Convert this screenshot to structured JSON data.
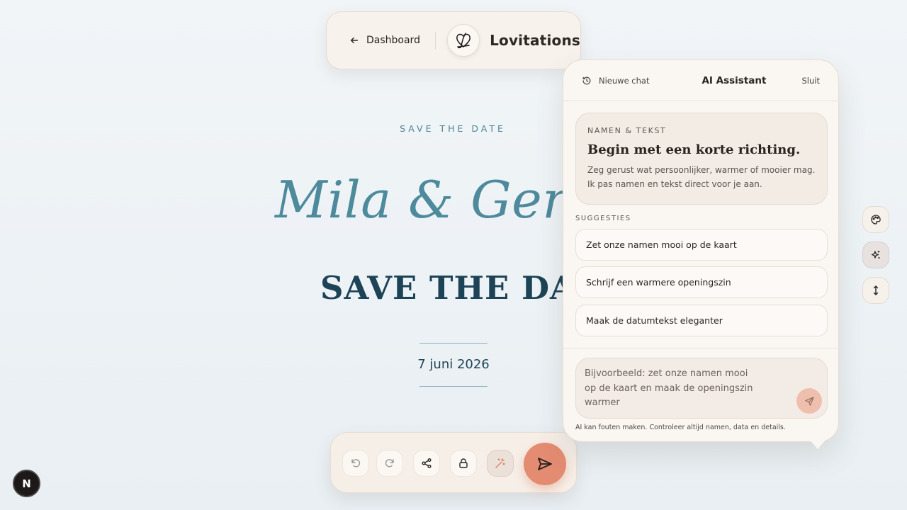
{
  "header": {
    "back_label": "Dashboard",
    "brand_name": "Lovitations",
    "logo_icon": "heart-signature-icon"
  },
  "canvas": {
    "eyebrow": "SAVE THE DATE",
    "names": "Mila & Gertj",
    "headline": "SAVE THE DAT",
    "date": "7 juni 2026"
  },
  "toolbar": {
    "buttons": [
      "undo-icon",
      "redo-icon",
      "share-icon",
      "lock-icon",
      "magic-wand-icon"
    ],
    "send_icon": "send-icon",
    "accent": "#e38c72"
  },
  "ai_panel": {
    "new_chat_label": "Nieuwe chat",
    "title": "AI Assistant",
    "close_label": "Sluit",
    "intro": {
      "eyebrow": "NAMEN & TEKST",
      "heading": "Begin met een korte richting.",
      "body": "Zeg gerust wat persoonlijker, warmer of mooier mag. Ik pas namen en tekst direct voor je aan."
    },
    "suggestions_label": "SUGGESTIES",
    "suggestions": [
      "Zet onze namen mooi op de kaart",
      "Schrijf een warmere openingszin",
      "Maak de datumtekst eleganter"
    ],
    "input_value": "",
    "input_placeholder": "Bijvoorbeeld: zet onze namen mooi op de kaart en maak de openingszin warmer",
    "disclaimer": "AI kan fouten maken. Controleer altijd namen, data en details."
  },
  "rail": {
    "buttons": [
      "palette-icon",
      "sparkles-icon",
      "vertical-resize-icon"
    ]
  },
  "badge": {
    "label": "N"
  }
}
